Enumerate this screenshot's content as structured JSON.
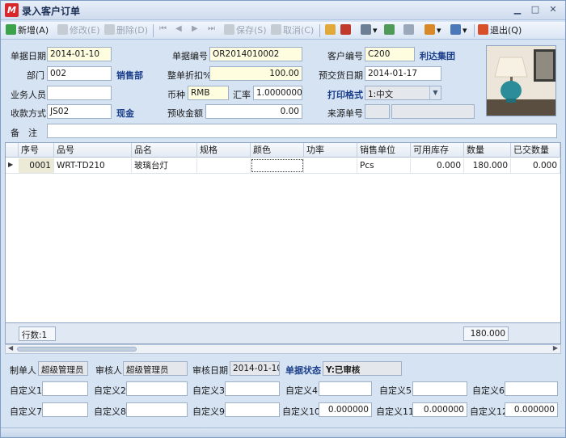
{
  "window": {
    "title": "录入客户订单",
    "logo": "M"
  },
  "toolbar": {
    "add": "新增(A)",
    "edit": "修改(E)",
    "delete": "删除(D)",
    "save": "保存(S)",
    "cancel": "取消(C)",
    "exit": "退出(Q)"
  },
  "header": {
    "doc_date_label": "单据日期",
    "doc_date": "2014-01-10",
    "doc_no_label": "单据编号",
    "doc_no": "OR2014010002",
    "customer_no_label": "客户编号",
    "customer_no": "C200",
    "customer_name": "利达集团",
    "dept_label": "部门",
    "dept": "002",
    "dept_name": "销售部",
    "discount_label": "整单折扣%",
    "discount": "100.00",
    "delivery_date_label": "预交货日期",
    "delivery_date": "2014-01-17",
    "salesperson_label": "业务人员",
    "salesperson": "",
    "currency_label": "币种",
    "currency": "RMB",
    "rate_label": "汇率",
    "rate": "1.0000000",
    "print_format_label": "打印格式",
    "print_format": "1:中文",
    "payment_label": "收款方式",
    "payment": "JS02",
    "payment_name": "现金",
    "prepay_label": "预收金额",
    "prepay": "0.00",
    "source_label": "来源单号",
    "source_no": "",
    "source_no2": "",
    "remark_label": "备　注",
    "remark": ""
  },
  "grid": {
    "columns": [
      "序号",
      "品号",
      "品名",
      "规格",
      "颜色",
      "功率",
      "销售单位",
      "可用库存",
      "数量",
      "已交数量"
    ],
    "rows": [
      [
        "0001",
        "WRT-TD210",
        "玻璃台灯",
        "",
        "",
        "",
        "Pcs",
        "0.000",
        "180.000",
        "0.000"
      ]
    ],
    "row_count": "行数:1",
    "total_qty": "180.000"
  },
  "footer": {
    "creator_label": "制单人",
    "creator": "超级管理员",
    "auditor_label": "审核人",
    "auditor": "超级管理员",
    "audit_date_label": "审核日期",
    "audit_date": "2014-01-10",
    "status_label": "单据状态",
    "status": "Y:已审核",
    "custom": [
      {
        "label": "自定义1",
        "value": ""
      },
      {
        "label": "自定义2",
        "value": ""
      },
      {
        "label": "自定义3",
        "value": ""
      },
      {
        "label": "自定义4",
        "value": ""
      },
      {
        "label": "自定义5",
        "value": ""
      },
      {
        "label": "自定义6",
        "value": ""
      },
      {
        "label": "自定义7",
        "value": ""
      },
      {
        "label": "自定义8",
        "value": ""
      },
      {
        "label": "自定义9",
        "value": ""
      },
      {
        "label": "自定义10",
        "value": "0.000000"
      },
      {
        "label": "自定义11",
        "value": "0.000000"
      },
      {
        "label": "自定义12",
        "value": "0.000000"
      }
    ]
  },
  "colors": {
    "accent": "#1b3f8b",
    "logo": "#d8262a",
    "field_yellow": "#fffde0"
  }
}
